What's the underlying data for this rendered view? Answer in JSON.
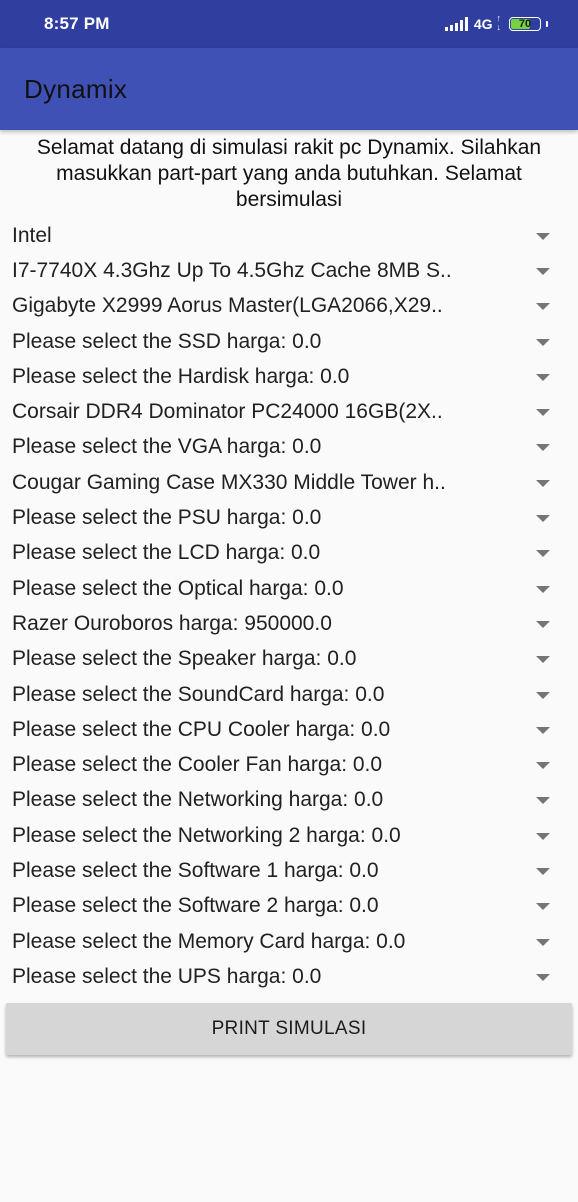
{
  "status_bar": {
    "time": "8:57 PM",
    "network": "4G",
    "battery_level": "70",
    "battery_fraction": 0.7,
    "battery_color": "#76d23a"
  },
  "app_bar": {
    "title": "Dynamix",
    "color": "#3f51b5"
  },
  "intro_text": "Selamat datang di simulasi rakit pc Dynamix. Silahkan masukkan part-part yang anda butuhkan. Selamat bersimulasi",
  "spinners": [
    {
      "name": "spinner-processor-brand",
      "label": "Intel"
    },
    {
      "name": "spinner-processor",
      "label": "I7-7740X 4.3Ghz Up To 4.5Ghz Cache 8MB S.."
    },
    {
      "name": "spinner-motherboard",
      "label": "Gigabyte X2999 Aorus Master(LGA2066,X29.."
    },
    {
      "name": "spinner-ssd",
      "label": "Please select the SSD harga: 0.0"
    },
    {
      "name": "spinner-hardisk",
      "label": "Please select the Hardisk harga: 0.0"
    },
    {
      "name": "spinner-memory",
      "label": "Corsair DDR4 Dominator PC24000 16GB(2X.."
    },
    {
      "name": "spinner-vga",
      "label": "Please select the VGA harga: 0.0"
    },
    {
      "name": "spinner-casing",
      "label": "Cougar Gaming Case MX330 Middle Tower h.."
    },
    {
      "name": "spinner-psu",
      "label": "Please select the PSU harga: 0.0"
    },
    {
      "name": "spinner-lcd",
      "label": "Please select the LCD harga: 0.0"
    },
    {
      "name": "spinner-optical",
      "label": "Please select the Optical harga: 0.0"
    },
    {
      "name": "spinner-mouse",
      "label": "Razer Ouroboros harga: 950000.0"
    },
    {
      "name": "spinner-speaker",
      "label": "Please select the Speaker harga: 0.0"
    },
    {
      "name": "spinner-soundcard",
      "label": "Please select the SoundCard harga: 0.0"
    },
    {
      "name": "spinner-cpu-cooler",
      "label": "Please select the CPU Cooler harga: 0.0"
    },
    {
      "name": "spinner-cooler-fan",
      "label": "Please select the Cooler Fan harga: 0.0"
    },
    {
      "name": "spinner-networking",
      "label": "Please select the Networking harga: 0.0"
    },
    {
      "name": "spinner-networking-2",
      "label": "Please select the Networking 2 harga: 0.0"
    },
    {
      "name": "spinner-software-1",
      "label": "Please select the Software 1 harga: 0.0"
    },
    {
      "name": "spinner-software-2",
      "label": "Please select the Software 2 harga: 0.0"
    },
    {
      "name": "spinner-memory-card",
      "label": "Please select the Memory Card harga: 0.0"
    },
    {
      "name": "spinner-ups",
      "label": "Please select the UPS harga: 0.0"
    }
  ],
  "print_button": {
    "label": "PRINT SIMULASI"
  }
}
